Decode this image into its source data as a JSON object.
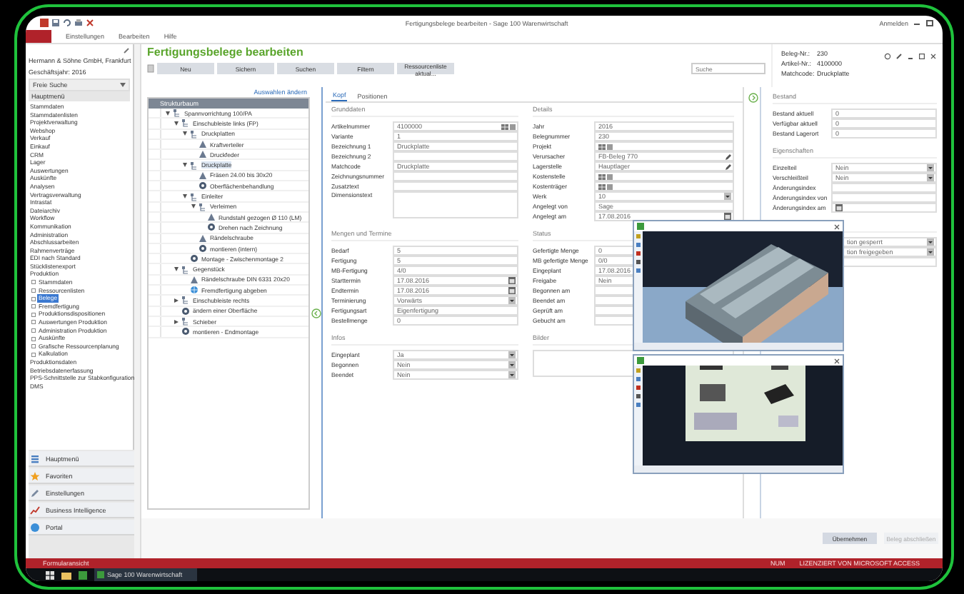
{
  "window": {
    "title": "Fertigungsbelege bearbeiten - Sage 100 Warenwirtschaft",
    "account": "Anmelden"
  },
  "menu": [
    "Einstellungen",
    "Bearbeiten",
    "Hilfe"
  ],
  "sidebar": {
    "company": "Hermann & Söhne GmbH, Frankfurt",
    "year": "Geschäftsjahr: 2016",
    "search": "Freie Suche",
    "section": "Hauptmenü",
    "items": [
      {
        "label": "Stammdaten",
        "selected": false
      },
      {
        "label": "Stammdatenlisten",
        "selected": false
      },
      {
        "label": "Projektverwaltung",
        "selected": false
      },
      {
        "label": "Webshop",
        "selected": false
      },
      {
        "label": "Verkauf",
        "selected": false
      },
      {
        "label": "Einkauf",
        "selected": false
      },
      {
        "label": "CRM",
        "selected": false
      },
      {
        "label": "Lager",
        "selected": false
      },
      {
        "label": "Auswertungen",
        "selected": false
      },
      {
        "label": "Auskünfte",
        "selected": false
      },
      {
        "label": "Analysen",
        "selected": false
      },
      {
        "label": "Vertragsverwaltung",
        "selected": false
      },
      {
        "label": "Intrastat",
        "selected": false
      },
      {
        "label": "Dateiarchiv",
        "selected": false
      },
      {
        "label": "Workflow",
        "selected": false
      },
      {
        "label": "Kommunikation",
        "selected": false
      },
      {
        "label": "Administration",
        "selected": false
      },
      {
        "label": "Abschlussarbeiten",
        "selected": false
      },
      {
        "label": "Rahmenverträge",
        "selected": false
      },
      {
        "label": "EDI nach Standard",
        "selected": false
      },
      {
        "label": "Stücklistenexport",
        "selected": false
      },
      {
        "label": "Produktion",
        "selected": false,
        "children": [
          {
            "label": "Stammdaten",
            "selected": false
          },
          {
            "label": "Ressourcenlisten",
            "selected": false
          },
          {
            "label": "Belege",
            "selected": true
          },
          {
            "label": "Fremdfertigung",
            "selected": false
          },
          {
            "label": "Produktionsdispositionen",
            "selected": false
          },
          {
            "label": "Auswertungen Produktion",
            "selected": false
          },
          {
            "label": "Administration Produktion",
            "selected": false
          },
          {
            "label": "Auskünfte",
            "selected": false
          },
          {
            "label": "Grafische Ressourcenplanung",
            "selected": false
          },
          {
            "label": "Kalkulation",
            "selected": false
          }
        ]
      },
      {
        "label": "Produktionsdaten",
        "selected": false
      },
      {
        "label": "Betriebsdatenerfassung",
        "selected": false
      },
      {
        "label": "PPS-Schnittstelle zur Stabkonfiguration",
        "selected": false
      },
      {
        "label": "DMS",
        "selected": false
      }
    ],
    "nav": [
      {
        "label": "Hauptmenü",
        "kind": "menu"
      },
      {
        "label": "Favoriten",
        "kind": "star"
      },
      {
        "label": "Einstellungen",
        "kind": "pen"
      },
      {
        "label": "Business Intelligence",
        "kind": "chart"
      },
      {
        "label": "Portal",
        "kind": "globe"
      }
    ]
  },
  "page": {
    "title": "Fertigungsbelege bearbeiten",
    "toolbar": [
      "Neu",
      "Sichern",
      "Suchen",
      "Filtern",
      "Ressourcenliste aktual..."
    ],
    "search": {
      "placeholder": "Suche"
    },
    "info": [
      {
        "label": "Beleg-Nr.:",
        "value": "230"
      },
      {
        "label": "Artikel-Nr.:",
        "value": "4100000"
      },
      {
        "label": "Matchcode:",
        "value": "Druckplatte"
      }
    ]
  },
  "tree": {
    "link": "Auswahlen ändern",
    "header": "Strukturbaum",
    "nodes": [
      {
        "label": "Spannvorrichtung 100/PA",
        "kind": "assembly",
        "selected": false,
        "children": [
          {
            "label": "Einschubleiste links (FP)",
            "kind": "assembly",
            "selected": false,
            "children": [
              {
                "label": "Druckplatten",
                "kind": "assembly",
                "selected": false,
                "children": [
                  {
                    "label": "Kraftverteiler",
                    "kind": "part",
                    "selected": false
                  },
                  {
                    "label": "Druckfeder",
                    "kind": "part",
                    "selected": false
                  }
                ]
              },
              {
                "label": "Druckplatte",
                "kind": "assembly",
                "selected": true,
                "children": [
                  {
                    "label": "Fräsen 24.00 bis 30x20",
                    "kind": "part",
                    "selected": false
                  },
                  {
                    "label": "Oberflächenbehandlung",
                    "kind": "operation",
                    "selected": false
                  }
                ]
              },
              {
                "label": "Einleiter",
                "kind": "assembly",
                "selected": false,
                "children": [
                  {
                    "label": "Verleimen",
                    "kind": "assembly",
                    "selected": false,
                    "children": [
                      {
                        "label": "Rundstahl gezogen Ø 110 (LM)",
                        "kind": "part",
                        "selected": false
                      },
                      {
                        "label": "Drehen nach Zeichnung",
                        "kind": "operation",
                        "selected": false
                      }
                    ]
                  },
                  {
                    "label": "Rändelschraube",
                    "kind": "part",
                    "selected": false
                  },
                  {
                    "label": "montieren (intern)",
                    "kind": "operation",
                    "selected": false
                  }
                ]
              },
              {
                "label": "Montage - Zwischenmontage 2",
                "kind": "operation",
                "selected": false
              }
            ]
          },
          {
            "label": "Gegenstück",
            "kind": "assembly",
            "selected": false,
            "children": [
              {
                "label": "Rändelschraube DIN 6331 20x20",
                "kind": "part",
                "selected": false
              },
              {
                "label": "Fremdfertigung abgeben",
                "kind": "external",
                "selected": false
              }
            ]
          },
          {
            "label": "Einschubleiste rechts",
            "kind": "assembly",
            "selected": false,
            "expanded": false
          },
          {
            "label": "ändern einer Oberfläche",
            "kind": "operation",
            "selected": false
          },
          {
            "label": "Schieber",
            "kind": "assembly",
            "selected": false,
            "expanded": false
          },
          {
            "label": "montieren - Endmontage",
            "kind": "operation",
            "selected": false
          }
        ]
      }
    ]
  },
  "form": {
    "tabs": [
      {
        "label": "Kopf",
        "selected": true
      },
      {
        "label": "Positionen",
        "selected": false
      }
    ],
    "rows": [
      [
        {
          "title": "Grunddaten",
          "fields": [
            {
              "label": "Artikelnummer",
              "value": "4100000",
              "kind": "lookup"
            },
            {
              "label": "Variante",
              "value": "1",
              "kind": "text"
            },
            {
              "label": "Bezeichnung 1",
              "value": "Druckplatte",
              "kind": "text"
            },
            {
              "label": "Bezeichnung 2",
              "kind": "text"
            },
            {
              "label": "Matchcode",
              "value": "Druckplatte",
              "kind": "text"
            },
            {
              "label": "Zeichnungsnummer",
              "kind": "text"
            },
            {
              "label": "Zusatztext",
              "kind": "text"
            },
            {
              "label": "Dimensionstext",
              "kind": "area"
            }
          ]
        },
        {
          "title": "Details",
          "fields": [
            {
              "label": "Jahr",
              "value": "2016",
              "kind": "text"
            },
            {
              "label": "Belegnummer",
              "value": "230",
              "kind": "text"
            },
            {
              "label": "Projekt",
              "kind": "lookup"
            },
            {
              "label": "Verursacher",
              "value": "FB-Beleg 770",
              "kind": "edit"
            },
            {
              "label": "Lagerstelle",
              "value": "Hauptlager",
              "kind": "edit"
            },
            {
              "label": "Kostenstelle",
              "kind": "lookup"
            },
            {
              "label": "Kostenträger",
              "kind": "lookup"
            },
            {
              "label": "Werk",
              "value": "10",
              "kind": "combo"
            },
            {
              "label": "Angelegt von",
              "value": "Sage",
              "kind": "text"
            },
            {
              "label": "Angelegt am",
              "value": "17.08.2016",
              "kind": "date"
            }
          ]
        }
      ],
      [
        {
          "title": "Mengen und Termine",
          "fields": [
            {
              "label": "Bedarf",
              "value": "5",
              "kind": "text"
            },
            {
              "label": "Fertigung",
              "value": "5",
              "kind": "text"
            },
            {
              "label": "MB-Fertigung",
              "value": "4/0",
              "kind": "text"
            },
            {
              "label": "Starttermin",
              "value": "17.08.2016",
              "kind": "date"
            },
            {
              "label": "Endtermin",
              "value": "17.08.2016",
              "kind": "date"
            },
            {
              "label": "Terminierung",
              "value": "Vorwärts",
              "kind": "combo"
            },
            {
              "label": "Fertigungsart",
              "value": "Eigenfertigung",
              "kind": "text"
            },
            {
              "label": "Bestellmenge",
              "value": "0",
              "kind": "text"
            }
          ]
        },
        {
          "title": "Status",
          "fields": [
            {
              "label": "Gefertigte Menge",
              "value": "0",
              "kind": "text"
            },
            {
              "label": "MB gefertigte Menge",
              "value": "0/0",
              "kind": "text"
            },
            {
              "label": "Eingeplant",
              "value": "17.08.2016",
              "kind": "text"
            },
            {
              "label": "Freigabe",
              "value": "Nein",
              "kind": "text"
            },
            {
              "label": "Begonnen am",
              "kind": "text"
            },
            {
              "label": "Beendet am",
              "kind": "text"
            },
            {
              "label": "Geprüft am",
              "kind": "text"
            },
            {
              "label": "Gebucht am",
              "kind": "text"
            }
          ]
        }
      ],
      [
        {
          "title": "Infos",
          "fields": [
            {
              "label": "Eingeplant",
              "value": "Ja",
              "kind": "combo"
            },
            {
              "label": "Begonnen",
              "value": "Nein",
              "kind": "combo"
            },
            {
              "label": "Beendet",
              "value": "Nein",
              "kind": "combo"
            }
          ]
        },
        {
          "title": "Bilder",
          "fields": [
            {
              "kind": "area"
            }
          ]
        }
      ]
    ]
  },
  "details": {
    "sections": [
      {
        "title": "Bestand",
        "fields": [
          {
            "label": "Bestand aktuell",
            "value": "0",
            "kind": "text"
          },
          {
            "label": "Verfügbar aktuell",
            "value": "0",
            "kind": "text"
          },
          {
            "label": "Bestand Lagerort",
            "value": "0",
            "kind": "text"
          }
        ]
      },
      {
        "title": "Eigenschaften",
        "fields": [
          {
            "label": "Einzelteil",
            "value": "Nein",
            "kind": "combo"
          },
          {
            "label": "Verschleißteil",
            "value": "Nein",
            "kind": "combo"
          },
          {
            "label": "Änderungsindex",
            "kind": "text"
          },
          {
            "label": "Änderungsindex von",
            "kind": "text"
          },
          {
            "label": "Änderungsindex am",
            "kind": "date"
          }
        ]
      },
      {
        "fields": [
          {
            "value": "tion gesperrt",
            "kind": "combo"
          },
          {
            "value": "tion freigegeben",
            "kind": "combo"
          },
          {
            "kind": "text"
          }
        ]
      }
    ]
  },
  "viewers": [
    {
      "kind": "picture"
    },
    {
      "kind": "picture"
    }
  ],
  "buttons": [
    {
      "label": "Übernehmen",
      "disabled": false
    },
    {
      "label": "Beleg abschließen",
      "disabled": true
    }
  ],
  "status_bar": {
    "left": "Formularansicht",
    "right": [
      "NUM",
      "LIZENZIERT VON MICROSOFT ACCESS"
    ]
  },
  "taskbar": {
    "task": "Sage 100 Warenwirtschaft"
  }
}
